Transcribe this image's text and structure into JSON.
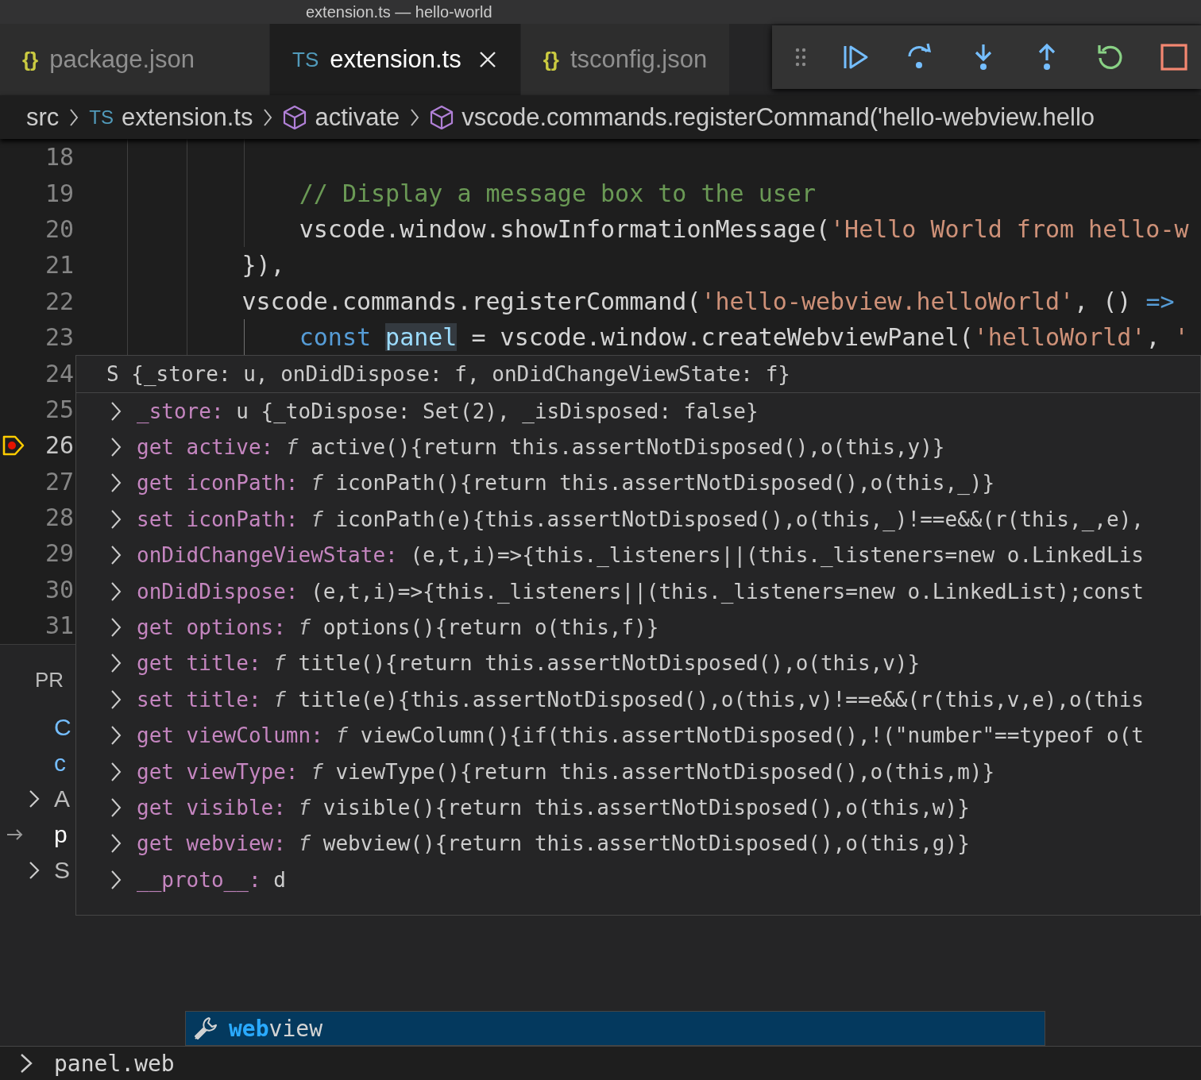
{
  "window": {
    "title": "extension.ts — hello-world"
  },
  "tabs": [
    {
      "badge": "{}",
      "kind": "json",
      "label": "package.json",
      "selected": false
    },
    {
      "badge": "TS",
      "kind": "ts",
      "label": "extension.ts",
      "selected": true
    },
    {
      "badge": "{}",
      "kind": "json",
      "label": "tsconfig.json",
      "selected": false
    }
  ],
  "debug_toolbar": {
    "buttons": [
      {
        "kind": "continue"
      },
      {
        "kind": "step-over"
      },
      {
        "kind": "step-into"
      },
      {
        "kind": "step-out"
      },
      {
        "kind": "restart"
      },
      {
        "kind": "stop"
      }
    ]
  },
  "breadcrumbs": [
    {
      "kind": "folder",
      "label": "src"
    },
    {
      "kind": "file",
      "badge": "TS",
      "label": "extension.ts"
    },
    {
      "kind": "symbol",
      "label": "activate"
    },
    {
      "kind": "symbol",
      "label": "vscode.commands.registerCommand('hello-webview.hello"
    }
  ],
  "editor": {
    "lines": [
      {
        "number": "18",
        "current": false
      },
      {
        "number": "19",
        "current": false,
        "tokens": [
          {
            "text": "            // Display a message box to the user",
            "kind": "comment"
          }
        ]
      },
      {
        "number": "20",
        "current": false,
        "tokens": [
          {
            "text": "            vscode.window.showInformationMessage(",
            "kind": "plain"
          },
          {
            "text": "'Hello World from hello-w",
            "kind": "string"
          }
        ]
      },
      {
        "number": "21",
        "current": false,
        "tokens": [
          {
            "text": "        }),",
            "kind": "plain"
          }
        ]
      },
      {
        "number": "22",
        "current": false,
        "tokens": [
          {
            "text": "        vscode.commands.registerCommand(",
            "kind": "plain"
          },
          {
            "text": "'hello-webview.helloWorld'",
            "kind": "string"
          },
          {
            "text": ", () ",
            "kind": "plain"
          },
          {
            "text": "=>",
            "kind": "keyword"
          }
        ]
      },
      {
        "number": "23",
        "current": false,
        "tokens": [
          {
            "text": "            const ",
            "kind": "keyword"
          },
          {
            "text": "panel",
            "kind": "highlight"
          },
          {
            "text": " = vscode.window.createWebviewPanel(",
            "kind": "plain"
          },
          {
            "text": "'helloWorld'",
            "kind": "string"
          },
          {
            "text": ", ",
            "kind": "plain"
          },
          {
            "text": "'",
            "kind": "string"
          }
        ]
      },
      {
        "number": "24",
        "current": false
      },
      {
        "number": "25",
        "current": false
      },
      {
        "number": "26",
        "current": true
      },
      {
        "number": "27",
        "current": false
      },
      {
        "number": "28",
        "current": false
      },
      {
        "number": "29",
        "current": false
      },
      {
        "number": "30",
        "current": false
      },
      {
        "number": "31",
        "current": false
      }
    ]
  },
  "hover": {
    "header": "S {_store: u, onDidDispose: f, onDidChangeViewState: f}",
    "rows": [
      {
        "key": "_store:",
        "value": "u {_toDispose: Set(2), _isDisposed: false}",
        "expanded": false
      },
      {
        "key": "get active:",
        "value": "*f* active(){return this.assertNotDisposed(),o(this,y)}",
        "expanded": false
      },
      {
        "key": "get iconPath:",
        "value": "*f* iconPath(){return this.assertNotDisposed(),o(this,_)}",
        "expanded": false
      },
      {
        "key": "set iconPath:",
        "value": "*f* iconPath(e){this.assertNotDisposed(),o(this,_)!==e&&(r(this,_,e),",
        "expanded": false
      },
      {
        "key": "onDidChangeViewState:",
        "value": "(e,t,i)=>{this._listeners||(this._listeners=new o.LinkedLis",
        "expanded": false
      },
      {
        "key": "onDidDispose:",
        "value": "(e,t,i)=>{this._listeners||(this._listeners=new o.LinkedList);const",
        "expanded": false
      },
      {
        "key": "get options:",
        "value": "*f* options(){return o(this,f)}",
        "expanded": false
      },
      {
        "key": "get title:",
        "value": "*f* title(){return this.assertNotDisposed(),o(this,v)}",
        "expanded": false
      },
      {
        "key": "set title:",
        "value": "*f* title(e){this.assertNotDisposed(),o(this,v)!==e&&(r(this,v,e),o(this",
        "expanded": false
      },
      {
        "key": "get viewColumn:",
        "value": "*f* viewColumn(){if(this.assertNotDisposed(),!(\"number\"==typeof o(t",
        "expanded": false
      },
      {
        "key": "get viewType:",
        "value": "*f* viewType(){return this.assertNotDisposed(),o(this,m)}",
        "expanded": false
      },
      {
        "key": "get visible:",
        "value": "*f* visible(){return this.assertNotDisposed(),o(this,w)}",
        "expanded": false
      },
      {
        "key": "get webview:",
        "value": "*f* webview(){return this.assertNotDisposed(),o(this,g)}",
        "expanded": false
      },
      {
        "key": "__proto__:",
        "value": "d",
        "expanded": false
      }
    ]
  },
  "side_panel": {
    "items": [
      {
        "kind": "heading",
        "label": "PR"
      },
      {
        "kind": "leaf",
        "label": "C"
      },
      {
        "kind": "leaf",
        "label": "c"
      },
      {
        "kind": "collapsed",
        "label": "A"
      },
      {
        "kind": "current",
        "label": "p"
      },
      {
        "kind": "collapsed",
        "label": "S"
      }
    ]
  },
  "suggest": {
    "items": [
      {
        "label": "**web**view",
        "selected": true
      }
    ]
  },
  "console": {
    "value": "panel.web"
  }
}
